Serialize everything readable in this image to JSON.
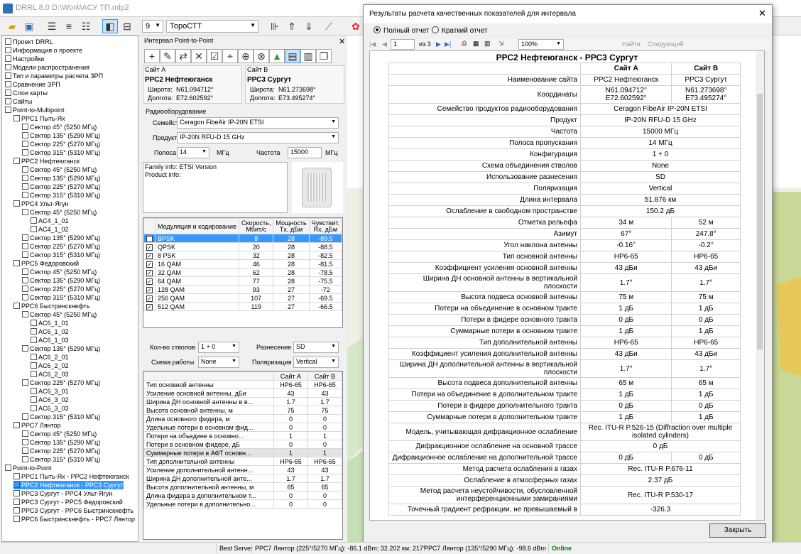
{
  "app": {
    "title": "DRRL 8.0 D:\\Work\\АСУ ТП.mlp2"
  },
  "toolbar": {
    "num_value": "9",
    "font_value": "ТороСТТ"
  },
  "tree": {
    "items": [
      {
        "text": "Проект DRRL",
        "indent": 0
      },
      {
        "text": "Информация о проекте",
        "indent": 0
      },
      {
        "text": "Настройки",
        "indent": 0
      },
      {
        "text": "Модели распространения",
        "indent": 0
      },
      {
        "text": "Тип и параметры расчета ЗРП",
        "indent": 0
      },
      {
        "text": "Сравнение ЗРП",
        "indent": 0
      },
      {
        "text": "Слои карты",
        "indent": 0
      },
      {
        "text": "Сайты",
        "indent": 0
      },
      {
        "text": "Point-to-Multipoint",
        "indent": 0
      },
      {
        "text": "РРС1 Пыть-Ях",
        "indent": 1
      },
      {
        "text": "Сектор 45° (5250 МГц)",
        "indent": 2
      },
      {
        "text": "Сектор 135° (5290 МГц)",
        "indent": 2
      },
      {
        "text": "Сектор 225° (5270 МГц)",
        "indent": 2
      },
      {
        "text": "Сектор 315° (5310 МГц)",
        "indent": 2
      },
      {
        "text": "РРС2 Нефтеюганск",
        "indent": 1
      },
      {
        "text": "Сектор 45° (5250 МГц)",
        "indent": 2
      },
      {
        "text": "Сектор 135° (5290 МГц)",
        "indent": 2
      },
      {
        "text": "Сектор 225° (5270 МГц)",
        "indent": 2
      },
      {
        "text": "Сектор 315° (5310 МГц)",
        "indent": 2
      },
      {
        "text": "РРС4 Ульт-Ягун",
        "indent": 1
      },
      {
        "text": "Сектор 45° (5250 МГц)",
        "indent": 2
      },
      {
        "text": "AC4_1_01",
        "indent": 3
      },
      {
        "text": "AC4_1_02",
        "indent": 3
      },
      {
        "text": "Сектор 135° (5290 МГц)",
        "indent": 2
      },
      {
        "text": "Сектор 225° (5270 МГц)",
        "indent": 2
      },
      {
        "text": "Сектор 315° (5310 МГц)",
        "indent": 2
      },
      {
        "text": "РРС5 Федоровский",
        "indent": 1
      },
      {
        "text": "Сектор 45° (5250 МГц)",
        "indent": 2
      },
      {
        "text": "Сектор 135° (5290 МГц)",
        "indent": 2
      },
      {
        "text": "Сектор 225° (5270 МГц)",
        "indent": 2
      },
      {
        "text": "Сектор 315° (5310 МГц)",
        "indent": 2
      },
      {
        "text": "РРС6 Быстринскнефть",
        "indent": 1
      },
      {
        "text": "Сектор 45° (5250 МГц)",
        "indent": 2
      },
      {
        "text": "AC6_1_01",
        "indent": 3
      },
      {
        "text": "AC6_1_02",
        "indent": 3
      },
      {
        "text": "AC6_1_03",
        "indent": 3
      },
      {
        "text": "Сектор 135° (5290 МГц)",
        "indent": 2
      },
      {
        "text": "AC6_2_01",
        "indent": 3
      },
      {
        "text": "AC6_2_02",
        "indent": 3
      },
      {
        "text": "AC6_2_03",
        "indent": 3
      },
      {
        "text": "Сектор 225° (5270 МГц)",
        "indent": 2
      },
      {
        "text": "AC6_3_01",
        "indent": 3
      },
      {
        "text": "AC6_3_02",
        "indent": 3
      },
      {
        "text": "AC6_3_03",
        "indent": 3
      },
      {
        "text": "Сектор 315° (5310 МГц)",
        "indent": 2
      },
      {
        "text": "РРС7 Лянтор",
        "indent": 1
      },
      {
        "text": "Сектор 45° (5250 МГц)",
        "indent": 2
      },
      {
        "text": "Сектор 135° (5290 МГц)",
        "indent": 2
      },
      {
        "text": "Сектор 225° (5270 МГц)",
        "indent": 2
      },
      {
        "text": "Сектор 315° (5310 МГц)",
        "indent": 2
      },
      {
        "text": "Point-to-Point",
        "indent": 0
      },
      {
        "text": "РРС1 Пыть-Ях - РРС2 Нефтеюганск",
        "indent": 1
      },
      {
        "text": "РРС2 Нефтеюганск - РРС3 Сургут",
        "indent": 1
      },
      {
        "text": "РРС3 Сургут - РРС4 Ульт-Ягун",
        "indent": 1
      },
      {
        "text": "РРС3 Сургут - РРС5 Федоровский",
        "indent": 1
      },
      {
        "text": "РРС3 Сургут - РРС6 Быстринскнефть",
        "indent": 1
      },
      {
        "text": "РРС6 Быстринскнефть - РРС7 Лянтор",
        "indent": 1
      }
    ]
  },
  "mid": {
    "header": "Интервал Point-to-Point",
    "site_a": {
      "caption": "Сайт А",
      "name": "РРС2 Нефтеюганск",
      "lat_label": "Широта:",
      "lat": "N61.094712°",
      "lon_label": "Долгота:",
      "lon": "E72.602592°"
    },
    "site_b": {
      "caption": "Сайт В",
      "name": "РРС3 Сургут",
      "lat_label": "Широта:",
      "lat": "N61.273698°",
      "lon_label": "Долгота:",
      "lon": "E73.495274°"
    },
    "radio_header": "Радиооборудование",
    "family_label": "Семейство",
    "family": "Ceragon FibeAir IP-20N ETSI",
    "product_label": "Продукт",
    "product": "IP-20N RFU-D 15 GHz",
    "band_label": "Полоса",
    "band": "14",
    "band_unit": "МГц",
    "freq_label": "Частота",
    "freq": "15000",
    "freq_unit": "МГц",
    "info_line1": "Family info: ETSI Version",
    "info_line2": "Product info:",
    "mod_headers": [
      "Модуляция и кодирование",
      "Скорость, Мбит/с",
      "Мощность Tx, дБм",
      "Чувствит. Rx, дБм"
    ],
    "mod_rows": [
      [
        "BPSK",
        "8",
        "28",
        "-89.5"
      ],
      [
        "QPSK",
        "20",
        "28",
        "-88.5"
      ],
      [
        "8 PSK",
        "32",
        "28",
        "-82.5"
      ],
      [
        "16 QAM",
        "46",
        "28",
        "-81.5"
      ],
      [
        "32 QAM",
        "62",
        "28",
        "-78.5"
      ],
      [
        "64 QAM",
        "77",
        "28",
        "-75.5"
      ],
      [
        "128 QAM",
        "93",
        "27",
        "-72"
      ],
      [
        "256 QAM",
        "107",
        "27",
        "-69.5"
      ],
      [
        "512 QAM",
        "119",
        "27",
        "-66.5"
      ]
    ],
    "trunks_label": "Кол-во стволов",
    "trunks": "1 + 0",
    "diversity_label": "Разнесение",
    "diversity": "SD",
    "scheme_label": "Схема работы",
    "scheme": "None",
    "polar_label": "Поляризация",
    "polar": "Vertical",
    "ant_headers": [
      "",
      "Сайт А",
      "Сайт В"
    ],
    "ant_rows": [
      [
        "Тип основной антенны",
        "HP6-65",
        "HP6-65"
      ],
      [
        "Усиление основной антенны, дБи",
        "43",
        "43"
      ],
      [
        "Ширина ДН основной антенны в в...",
        "1.7",
        "1.7"
      ],
      [
        "Высота основной антенны, м",
        "75",
        "75"
      ],
      [
        "Длина основного фидера, м",
        "0",
        "0"
      ],
      [
        "Удельные потери в основном фид...",
        "0",
        "0"
      ],
      [
        "Потери на объедине в основно...",
        "1",
        "1"
      ],
      [
        "Потери в основном фидере, дБ",
        "0",
        "0"
      ],
      [
        "Суммарные потери в АФТ основн...",
        "1",
        "1"
      ],
      [
        "Тип дополнительной антенны",
        "HP6-65",
        "HP6-65"
      ],
      [
        "Усиление дополнительной антенн...",
        "43",
        "43"
      ],
      [
        "Ширина ДН дополнительной анте...",
        "1.7",
        "1.7"
      ],
      [
        "Высота дополнительной антенны, м",
        "65",
        "65"
      ],
      [
        "Длина фидера в дополнительном т...",
        "0",
        "0"
      ],
      [
        "Удельные потери в дополнительно...",
        "0",
        "0"
      ]
    ]
  },
  "dialog": {
    "title": "Результаты расчета качественных показателей для интервала",
    "full_report": "Полный отчет",
    "short_report": "Краткий отчет",
    "page": "1",
    "page_of": "из 3",
    "zoom": "100%",
    "find": "Найти",
    "next": "Следующий",
    "report_title": "РРС2 Нефтеюганск - РРС3 Сургут",
    "col_a": "Сайт А",
    "col_b": "Сайт В",
    "rows": [
      {
        "k": "Наименование сайта",
        "a": "РРС2 Нефтеюганск",
        "b": "РРС3 Сургут"
      },
      {
        "k": "Координаты",
        "a": "N61.094712°\nE72.602592°",
        "b": "N61.273698°\nE73.495274°"
      },
      {
        "k": "Семейство продуктов радиооборудования",
        "span": "Ceragon FibeAir IP-20N ETSI"
      },
      {
        "k": "Продукт",
        "span": "IP-20N RFU-D 15 GHz"
      },
      {
        "k": "Частота",
        "span": "15000 МГц"
      },
      {
        "k": "Полоса пропускания",
        "span": "14 МГц"
      },
      {
        "k": "Конфигурация",
        "span": "1 + 0"
      },
      {
        "k": "Схема объединения стволов",
        "span": "None"
      },
      {
        "k": "Использование разнесения",
        "span": "SD"
      },
      {
        "k": "Поляризация",
        "span": "Vertical"
      },
      {
        "k": "Длина интервала",
        "span": "51.876 км"
      },
      {
        "k": "Ослабление в свободном пространстве",
        "span": "150.2 дБ"
      },
      {
        "k": "Отметка рельефа",
        "a": "34 м",
        "b": "52 м"
      },
      {
        "k": "Азимут",
        "a": "67°",
        "b": "247.8°"
      },
      {
        "k": "Угол наклона антенны",
        "a": "-0.16°",
        "b": "-0.2°"
      },
      {
        "k": "Тип основной антенны",
        "a": "HP6-65",
        "b": "HP6-65"
      },
      {
        "k": "Коэффициент усиления основной антенны",
        "a": "43 дБи",
        "b": "43 дБи"
      },
      {
        "k": "Ширина ДН основной антенны в вертикальной плоскости",
        "a": "1.7°",
        "b": "1.7°"
      },
      {
        "k": "Высота подвеса основной антенны",
        "a": "75 м",
        "b": "75 м"
      },
      {
        "k": "Потери на объединение в основном тракте",
        "a": "1 дБ",
        "b": "1 дБ"
      },
      {
        "k": "Потери в фидере основного тракта",
        "a": "0 дБ",
        "b": "0 дБ"
      },
      {
        "k": "Суммарные потери в основном тракте",
        "a": "1 дБ",
        "b": "1 дБ"
      },
      {
        "k": "Тип дополнительной антенны",
        "a": "HP6-65",
        "b": "HP6-65"
      },
      {
        "k": "Коэффициент усиления дополнительной антенны",
        "a": "43 дБи",
        "b": "43 дБи"
      },
      {
        "k": "Ширина ДН дополнительной антенны в вертикальной плоскости",
        "a": "1.7°",
        "b": "1.7°"
      },
      {
        "k": "Высота подвеса дополнительной антенны",
        "a": "65 м",
        "b": "65 м"
      },
      {
        "k": "Потери на объединение в дополнительном тракте",
        "a": "1 дБ",
        "b": "1 дБ"
      },
      {
        "k": "Потери в фидере дополнительного тракта",
        "a": "0 дБ",
        "b": "0 дБ"
      },
      {
        "k": "Суммарные потери в дополнительном тракте",
        "a": "1 дБ",
        "b": "1 дБ"
      },
      {
        "k": "Модель, учитывающая дифракционное ослабление",
        "span": "Rec. ITU-R P.526-15 (Diffraction over multiple isolated cylinders)"
      },
      {
        "k": "Дифракционное ослабление на основной трассе",
        "span": "0 дБ"
      },
      {
        "k": "Дифракционное ослабление на дополнительной трассе",
        "a": "0 дБ",
        "b": "0 дБ"
      },
      {
        "k": "Метод расчета ослабления в газах",
        "span": "Rec. ITU-R P.676-11"
      },
      {
        "k": "Ослабление в атмосферных газах",
        "span": "2.37 дБ"
      },
      {
        "k": "Метод расчета неустойчивости, обусловленной интерференционными замираниями",
        "span": "Rec. ITU-R P.530-17"
      },
      {
        "k": "Точечный градиент рефракции, не превышаемый в",
        "span": "-326.3"
      }
    ],
    "close": "Закрыть"
  },
  "status": {
    "best_server": "Best Server",
    "s1": "РРС7 Лянтор (225°/5270 МГц): -86.1 dBm; 32.202 км; 217°",
    "s2": "РРС7 Лянтор (135°/5290 МГц): -98.6 dBm",
    "online": "Online"
  },
  "colors": {
    "accent": "#0078d7",
    "online": "#008000",
    "selected_row": "#3399ff"
  },
  "icons": [
    "folder-open-icon",
    "save-icon",
    "tree-icon",
    "layout-icon",
    "ruler-icon",
    "settings-icon"
  ]
}
